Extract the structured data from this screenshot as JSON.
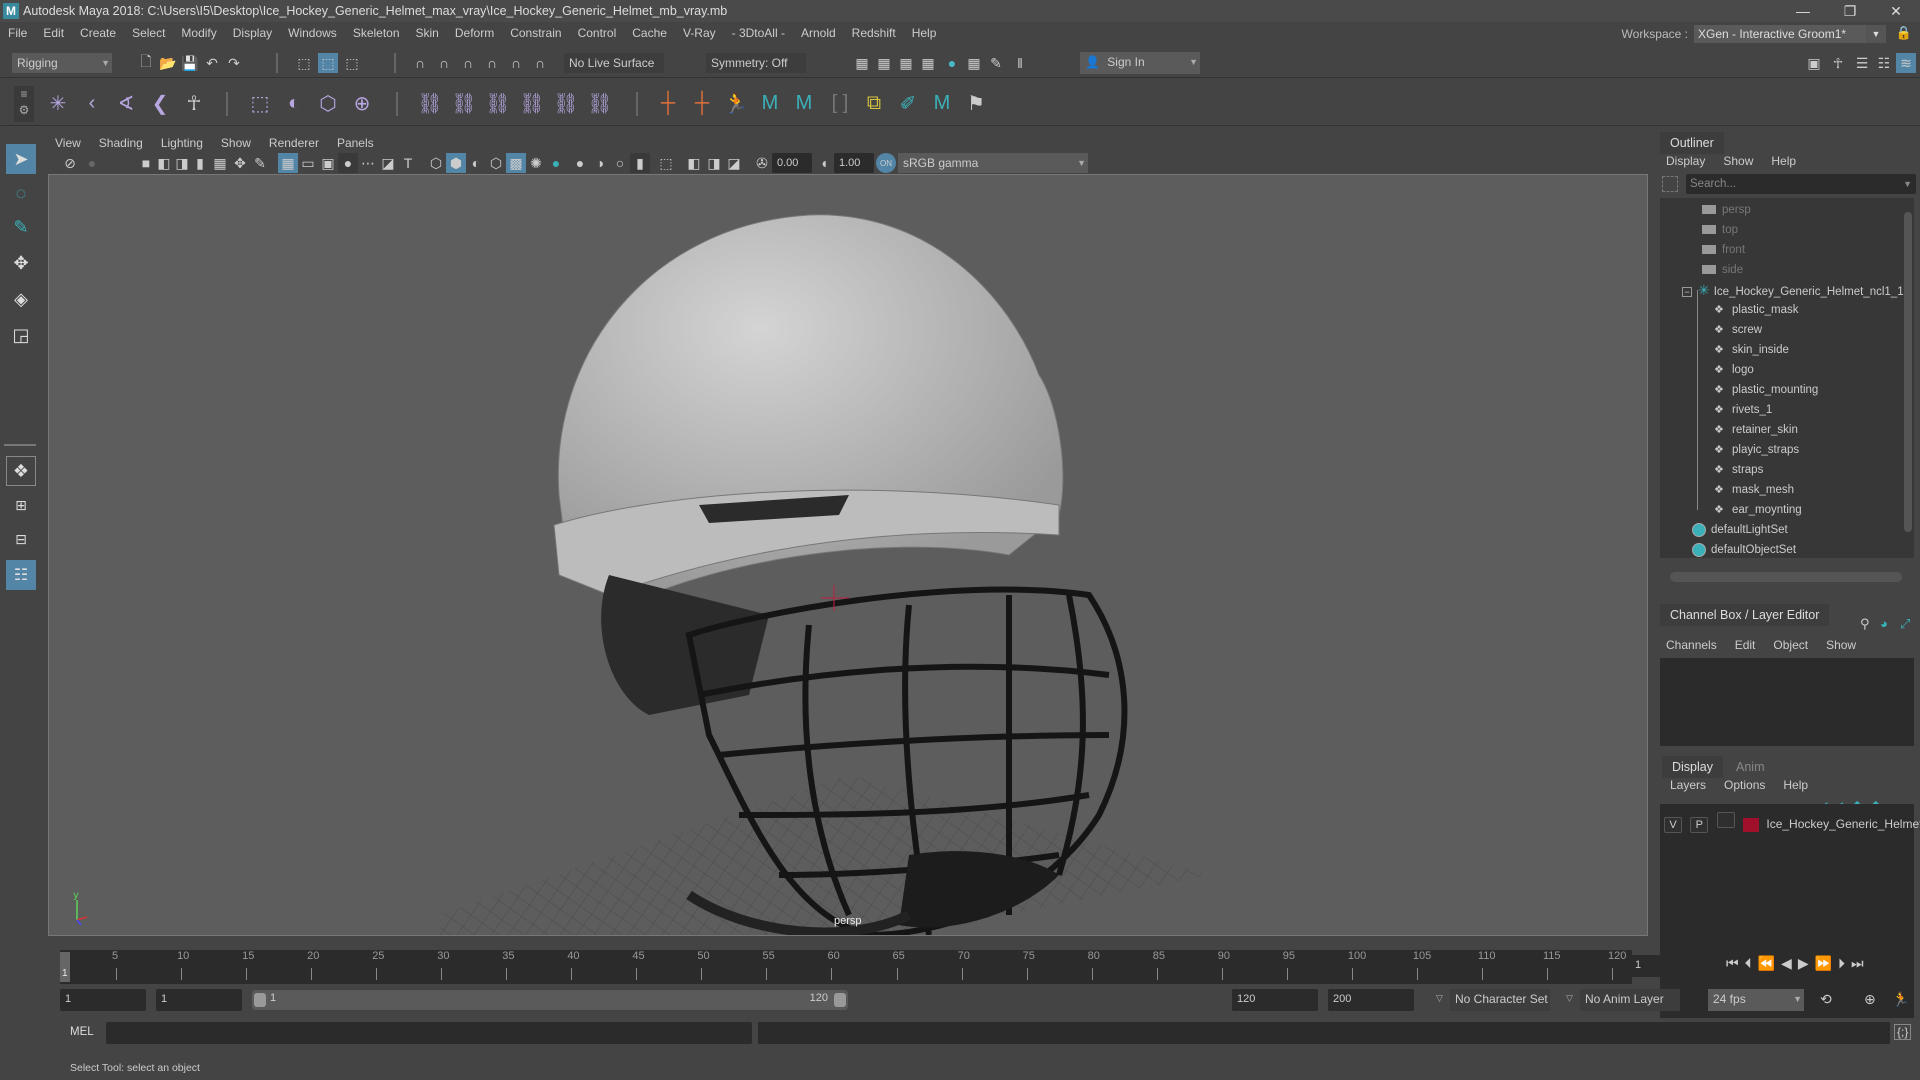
{
  "window": {
    "title": "Autodesk Maya 2018: C:\\Users\\I5\\Desktop\\Ice_Hockey_Generic_Helmet_max_vray\\Ice_Hockey_Generic_Helmet_mb_vray.mb",
    "logo": "M",
    "controls": {
      "minimize": "—",
      "restore": "❐",
      "close": "✕"
    }
  },
  "menubar": {
    "items": [
      "File",
      "Edit",
      "Create",
      "Select",
      "Modify",
      "Display",
      "Windows",
      "Skeleton",
      "Skin",
      "Deform",
      "Constrain",
      "Control",
      "Cache",
      "V-Ray",
      "- 3DtoAll -",
      "Arnold",
      "Redshift",
      "Help"
    ],
    "workspace_label": "Workspace :",
    "workspace_value": "XGen - Interactive Groom1*"
  },
  "statusline": {
    "mode": "Rigging",
    "live_surface": "No Live Surface",
    "symmetry": "Symmetry: Off",
    "sign_in": "Sign In"
  },
  "viewport": {
    "menu": [
      "View",
      "Shading",
      "Lighting",
      "Show",
      "Renderer",
      "Panels"
    ],
    "exposure": "0.00",
    "gamma": "1.00",
    "color_space": "sRGB gamma",
    "camera_label": "persp",
    "axis": {
      "y": "y",
      "z": "z"
    }
  },
  "outliner": {
    "tab": "Outliner",
    "menu": [
      "Display",
      "Show",
      "Help"
    ],
    "search_placeholder": "Search...",
    "cameras": [
      "persp",
      "top",
      "front",
      "side"
    ],
    "group": "Ice_Hockey_Generic_Helmet_ncl1_1",
    "children": [
      "plastic_mask",
      "screw",
      "skin_inside",
      "logo",
      "plastic_mounting",
      "rivets_1",
      "retainer_skin",
      "playic_straps",
      "straps",
      "mask_mesh",
      "ear_moynting"
    ],
    "sets": [
      "defaultLightSet",
      "defaultObjectSet"
    ]
  },
  "channelbox": {
    "tab": "Channel Box / Layer Editor",
    "menu": [
      "Channels",
      "Edit",
      "Object",
      "Show"
    ]
  },
  "layers": {
    "tabs": [
      "Display",
      "Anim"
    ],
    "menu": [
      "Layers",
      "Options",
      "Help"
    ],
    "rows": [
      {
        "v": "V",
        "p": "P",
        "name": "Ice_Hockey_Generic_Helmet",
        "color": "#a0102a"
      }
    ]
  },
  "timeline": {
    "ticks": [
      "5",
      "10",
      "15",
      "20",
      "25",
      "30",
      "35",
      "40",
      "45",
      "50",
      "55",
      "60",
      "65",
      "70",
      "75",
      "80",
      "85",
      "90",
      "95",
      "100",
      "105",
      "110",
      "115",
      "120"
    ],
    "current_frame_marker": "1",
    "current_frame": "1",
    "range_start": "1",
    "playback_start": "1",
    "slider_start": "1",
    "slider_end": "120",
    "playback_end": "120",
    "range_end": "200",
    "character_set": "No Character Set",
    "anim_layer": "No Anim Layer",
    "fps": "24 fps"
  },
  "cmdline": {
    "label": "MEL"
  },
  "helpline": {
    "text": "Select Tool: select an object"
  }
}
